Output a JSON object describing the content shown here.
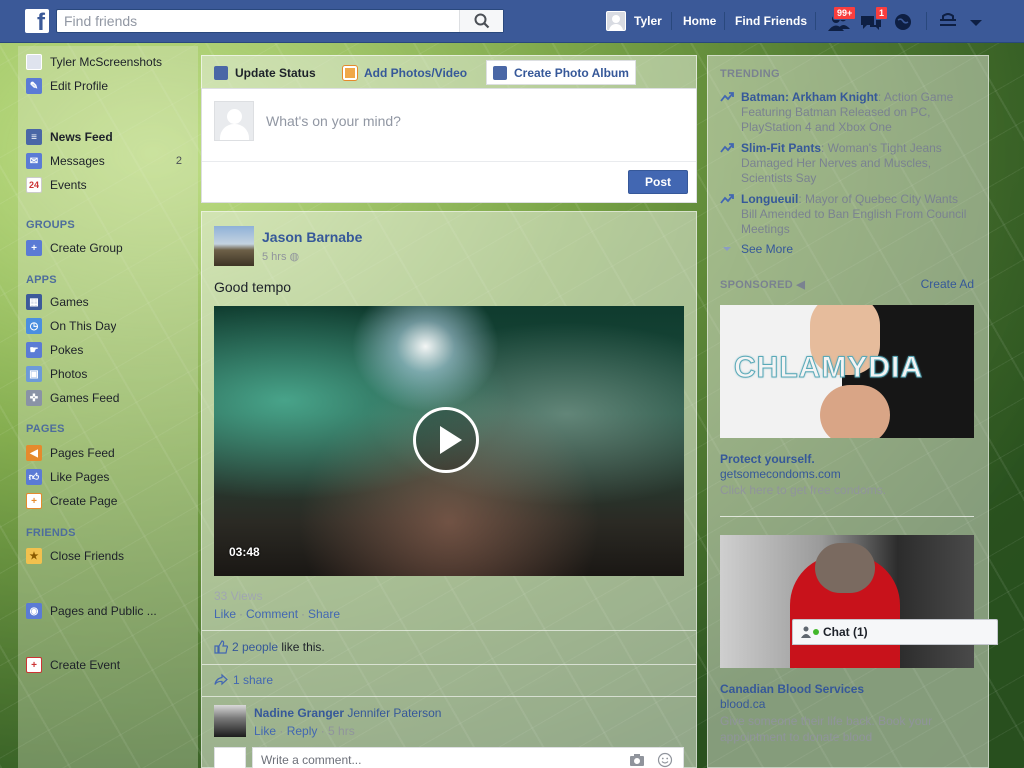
{
  "header": {
    "search_placeholder": "Find friends",
    "user_name": "Tyler",
    "home": "Home",
    "find_friends": "Find Friends",
    "friend_requests_badge": "99+",
    "messages_badge": "1"
  },
  "leftnav": {
    "profile_name": "Tyler McScreenshots",
    "edit_profile": "Edit Profile",
    "favorites": [
      {
        "label": "News Feed",
        "icon": "news-feed-icon"
      },
      {
        "label": "Messages",
        "count": "2",
        "icon": "messages-icon"
      },
      {
        "label": "Events",
        "icon": "events-icon",
        "icon_text": "24"
      }
    ],
    "groups_heading": "GROUPS",
    "create_group": "Create Group",
    "apps_heading": "APPS",
    "apps": [
      "Games",
      "On This Day",
      "Pokes",
      "Photos",
      "Games Feed"
    ],
    "pages_heading": "PAGES",
    "pages": [
      "Pages Feed",
      "Like Pages",
      "Create Page"
    ],
    "friends_heading": "FRIENDS",
    "close_friends": "Close Friends",
    "pages_public": "Pages and Public ...",
    "create_event": "Create Event"
  },
  "composer": {
    "tab_update": "Update Status",
    "tab_photos": "Add Photos/Video",
    "tab_album": "Create Photo Album",
    "placeholder": "What's on your mind?",
    "post": "Post"
  },
  "story": {
    "author": "Jason Barnabe",
    "time": "5 hrs",
    "text": "Good tempo",
    "duration": "03:48",
    "views": "33 Views",
    "action_like": "Like",
    "action_comment": "Comment",
    "action_share": "Share",
    "likes_link": "2 people",
    "likes_suffix": "like this.",
    "shares": "1 share",
    "comment": {
      "author": "Nadine Granger",
      "text": "Jennifer Paterson",
      "like": "Like",
      "reply": "Reply",
      "time": "5 hrs"
    },
    "write_placeholder": "Write a comment..."
  },
  "rightcol": {
    "trending_heading": "TRENDING",
    "trends": [
      {
        "title": "Batman: Arkham Knight",
        "text": ": Action Game Featuring Batman Released on PC, PlayStation 4 and Xbox One"
      },
      {
        "title": "Slim-Fit Pants",
        "text": ": Woman's Tight Jeans Damaged Her Nerves and Muscles, Scientists Say"
      },
      {
        "title": "Longueuil",
        "text": ": Mayor of Quebec City Wants Bill Amended to Ban English From Council Meetings"
      }
    ],
    "see_more": "See More",
    "sponsored_heading": "SPONSORED",
    "create_ad": "Create Ad",
    "ads": [
      {
        "image_text": "CHLAMYDIA",
        "title": "Protect yourself.",
        "link": "getsomecondoms.com",
        "desc": "Click here to get free condoms."
      },
      {
        "title": "Canadian Blood Services",
        "link": "blood.ca",
        "desc": "Give someone their life back. Book your appointment to donate blood"
      }
    ]
  },
  "chat": {
    "label": "Chat (1)"
  },
  "colors": {
    "brand": "#3b5998",
    "link": "#365899",
    "button": "#4267b2",
    "badge": "#fa3e3e"
  }
}
